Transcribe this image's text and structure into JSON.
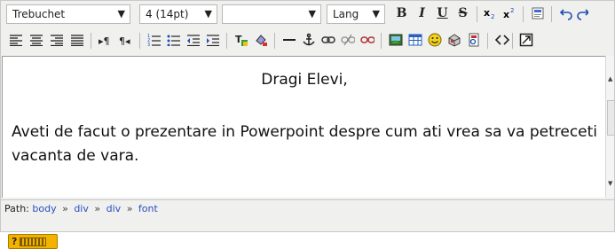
{
  "toolbar": {
    "font_family": "Trebuchet",
    "font_size": "4 (14pt)",
    "format": "",
    "lang": "Lang",
    "bold": "B",
    "italic": "I",
    "underline": "U",
    "strikethrough": "S"
  },
  "content": {
    "greeting": "Dragi Elevi,",
    "paragraph": "Aveti de facut o prezentare in Powerpoint despre cum ati vrea sa va petreceti vacanta de vara."
  },
  "pathbar": {
    "label": "Path:",
    "items": [
      "body",
      "div",
      "div",
      "font"
    ],
    "separator": "»"
  },
  "colors": {
    "toolbar_bg": "#f0f0ee",
    "link": "#2a4fbf",
    "help_bg": "#f2b300"
  }
}
